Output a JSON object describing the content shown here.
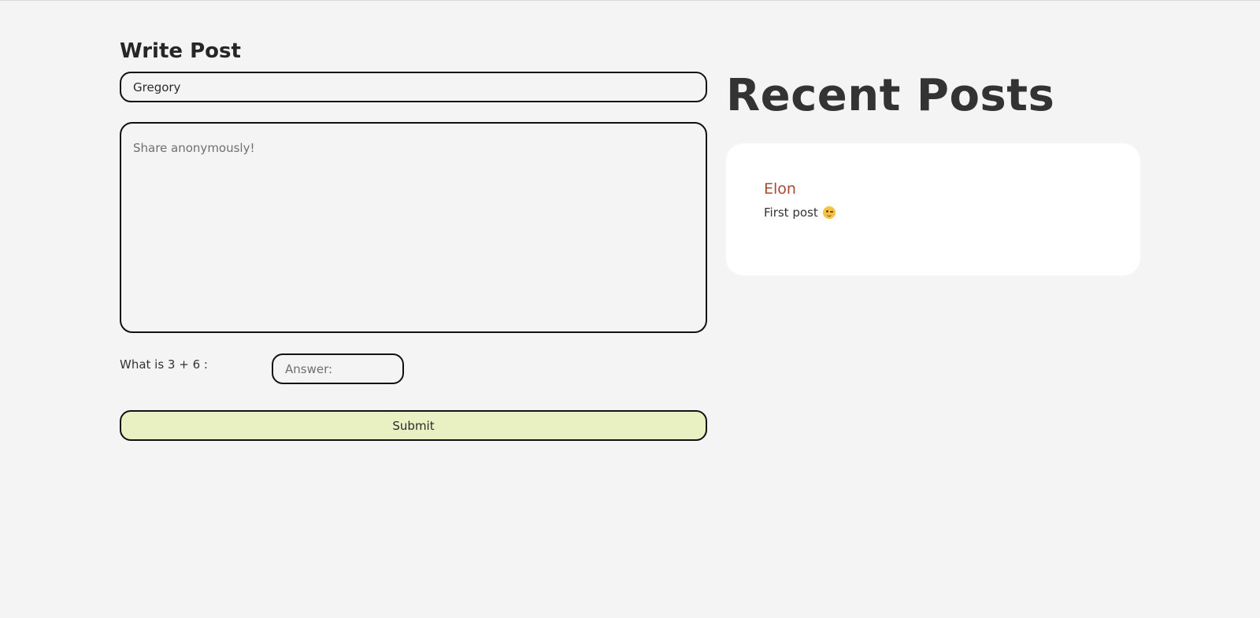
{
  "write_post": {
    "title": "Write Post",
    "name_value": "Gregory",
    "message_placeholder": "Share anonymously!",
    "captcha_label": "What is 3 + 6 :",
    "answer_placeholder": "Answer:",
    "submit_label": "Submit"
  },
  "recent_posts": {
    "title": "Recent Posts",
    "posts": [
      {
        "author": "Elon",
        "body": "First post",
        "emoji": "winking-face-icon"
      }
    ]
  },
  "colors": {
    "background": "#f4f4f4",
    "author": "#a8482f",
    "submit_bg": "#e9f0c1",
    "card_bg": "#ffffff"
  }
}
